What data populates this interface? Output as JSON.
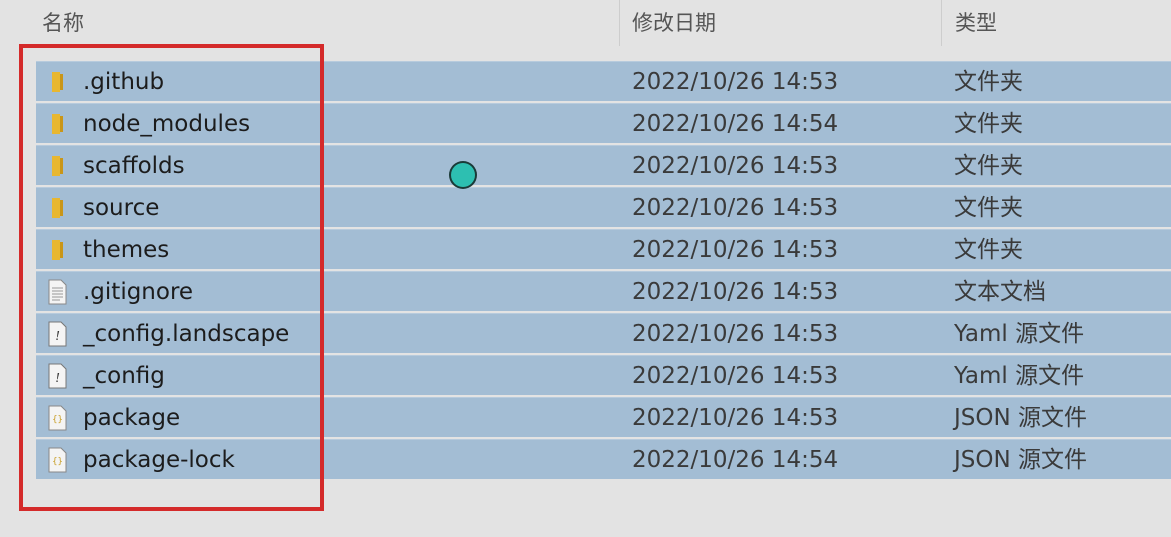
{
  "header": {
    "name_label": "名称",
    "date_label": "修改日期",
    "type_label": "类型",
    "sort_indicator": "^"
  },
  "files": [
    {
      "name": ".github",
      "date": "2022/10/26 14:53",
      "type": "文件夹",
      "icon": "folder-icon"
    },
    {
      "name": "node_modules",
      "date": "2022/10/26 14:54",
      "type": "文件夹",
      "icon": "folder-icon"
    },
    {
      "name": "scaffolds",
      "date": "2022/10/26 14:53",
      "type": "文件夹",
      "icon": "folder-icon"
    },
    {
      "name": "source",
      "date": "2022/10/26 14:53",
      "type": "文件夹",
      "icon": "folder-icon"
    },
    {
      "name": "themes",
      "date": "2022/10/26 14:53",
      "type": "文件夹",
      "icon": "folder-icon"
    },
    {
      "name": ".gitignore",
      "date": "2022/10/26 14:53",
      "type": "文本文档",
      "icon": "text-file-icon"
    },
    {
      "name": "_config.landscape",
      "date": "2022/10/26 14:53",
      "type": "Yaml 源文件",
      "icon": "yaml-file-icon"
    },
    {
      "name": "_config",
      "date": "2022/10/26 14:53",
      "type": "Yaml 源文件",
      "icon": "yaml-file-icon"
    },
    {
      "name": "package",
      "date": "2022/10/26 14:53",
      "type": "JSON 源文件",
      "icon": "json-file-icon"
    },
    {
      "name": "package-lock",
      "date": "2022/10/26 14:54",
      "type": "JSON 源文件",
      "icon": "json-file-icon"
    }
  ],
  "colors": {
    "selection": "#a3bdd4",
    "annotation_box": "#d42a2a",
    "cursor": "#2dbfb1",
    "folder": "#e8b730"
  }
}
